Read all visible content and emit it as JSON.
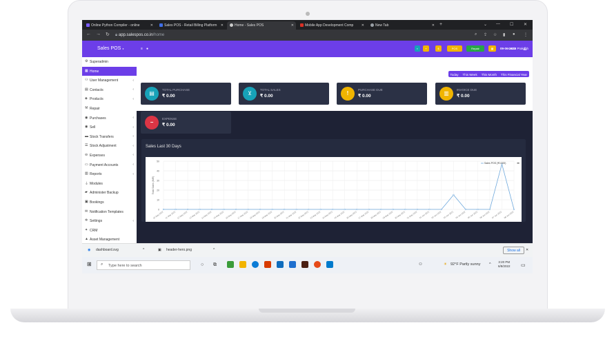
{
  "browser": {
    "tabs": [
      {
        "label": "Online Python Compiler - online",
        "color": "#7b5cff"
      },
      {
        "label": "Sales POS - Retail Billing Platform",
        "color": "#3f6ee8"
      },
      {
        "label": "Home - Sales POS",
        "color": "#cccccc"
      },
      {
        "label": "Mobile App Development Comp",
        "color": "#d93025"
      },
      {
        "label": "New Tab",
        "color": "#9aa0a6"
      }
    ],
    "url_host": "app.salespos.co.in",
    "url_path": "/home"
  },
  "app": {
    "brand": "Sales POS",
    "date": "09-06-2022",
    "user": "Lenin Prakash",
    "pos_label": "POS",
    "repair_label": "Repair"
  },
  "sidebar": {
    "items": [
      {
        "label": "Superadmin",
        "icon": "users-gear-icon",
        "chevron": false,
        "active": false
      },
      {
        "label": "Home",
        "icon": "dashboard-icon",
        "chevron": false,
        "active": true
      },
      {
        "label": "User Management",
        "icon": "users-icon",
        "chevron": true,
        "active": false
      },
      {
        "label": "Contacts",
        "icon": "address-book-icon",
        "chevron": true,
        "active": false
      },
      {
        "label": "Products",
        "icon": "cubes-icon",
        "chevron": true,
        "active": false
      },
      {
        "label": "Repair",
        "icon": "wrench-icon",
        "chevron": false,
        "active": false
      },
      {
        "label": "Purchases",
        "icon": "circle-arrow-icon",
        "chevron": true,
        "active": false
      },
      {
        "label": "Sell",
        "icon": "circle-arrow-up-icon",
        "chevron": true,
        "active": false
      },
      {
        "label": "Stock Transfers",
        "icon": "truck-icon",
        "chevron": true,
        "active": false
      },
      {
        "label": "Stock Adjustment",
        "icon": "database-icon",
        "chevron": true,
        "active": false
      },
      {
        "label": "Expenses",
        "icon": "minus-circle-icon",
        "chevron": true,
        "active": false
      },
      {
        "label": "Payment Accounts",
        "icon": "money-icon",
        "chevron": true,
        "active": false
      },
      {
        "label": "Reports",
        "icon": "bar-chart-icon",
        "chevron": true,
        "active": false
      },
      {
        "label": "Modules",
        "icon": "plug-icon",
        "chevron": false,
        "active": false
      },
      {
        "label": "Administer Backup",
        "icon": "hdd-icon",
        "chevron": false,
        "active": false
      },
      {
        "label": "Bookings",
        "icon": "calendar-check-icon",
        "chevron": false,
        "active": false
      },
      {
        "label": "Notification Templates",
        "icon": "envelope-icon",
        "chevron": false,
        "active": false
      },
      {
        "label": "Settings",
        "icon": "cog-icon",
        "chevron": true,
        "active": false
      },
      {
        "label": "CRM",
        "icon": "crm-icon",
        "chevron": false,
        "active": false
      },
      {
        "label": "Asset Management",
        "icon": "asset-icon",
        "chevron": false,
        "active": false
      }
    ]
  },
  "filters": [
    "Today",
    "This Week",
    "This Month",
    "This Financial Year"
  ],
  "cards": [
    {
      "label": "TOTAL PURCHASE",
      "value": "₹ 0.00",
      "color": "#17a2b8",
      "icon": "money-bill-icon"
    },
    {
      "label": "TOTAL SALES",
      "value": "₹ 0.00",
      "color": "#17a2b8",
      "icon": "cart-icon"
    },
    {
      "label": "PURCHASE DUE",
      "value": "₹ 0.00",
      "color": "#f0b400",
      "icon": "exclamation-icon"
    },
    {
      "label": "INVOICE DUE",
      "value": "₹ 0.00",
      "color": "#f0b400",
      "icon": "invoice-icon"
    },
    {
      "label": "EXPENSE",
      "value": "₹ 0.00",
      "color": "#dc3545",
      "icon": "minus-icon"
    }
  ],
  "sales_panel": {
    "title": "Sales Last 30 Days"
  },
  "chart_data": {
    "type": "line",
    "title": "",
    "xlabel": "",
    "ylabel": "Total Sales (INR)",
    "ylim": [
      0,
      50
    ],
    "y_ticks": [
      0,
      10,
      20,
      30,
      40,
      50
    ],
    "legend": "top-right",
    "grid": true,
    "series": [
      {
        "name": "Sales POS (₹0.000)",
        "color": "#6ea8dc",
        "values": [
          0,
          0,
          0,
          0,
          0,
          0,
          0,
          0,
          0,
          0,
          0,
          0,
          0,
          0,
          0,
          0,
          0,
          0,
          0,
          0,
          0,
          0,
          0,
          0,
          15,
          0,
          0,
          0,
          47,
          0
        ]
      }
    ],
    "categories": [
      "10 May 2022",
      "11 May 2022",
      "12 May 2022",
      "13 May 2022",
      "14 May 2022",
      "15 May 2022",
      "16 May 2022",
      "17 May 2022",
      "18 May 2022",
      "19 May 2022",
      "20 May 2022",
      "21 May 2022",
      "22 May 2022",
      "23 May 2022",
      "24 May 2022",
      "25 May 2022",
      "26 May 2022",
      "27 May 2022",
      "28 May 2022",
      "29 May 2022",
      "30 May 2022",
      "31 May 2022",
      "01 Jun 2022",
      "02 Jun 2022",
      "03 Jun 2022",
      "04 Jun 2022",
      "05 Jun 2022",
      "06 Jun 2022",
      "07 Jun 2022",
      "08 Jun 2022"
    ]
  },
  "downloads": [
    {
      "label": "dashboard.svg"
    },
    {
      "label": "header-hero.png"
    }
  ],
  "downloads_show_all": "Show all",
  "taskbar": {
    "search_placeholder": "Type here to search",
    "weather": "92°F  Partly sunny",
    "time": "3:20 PM",
    "date": "6/8/2022"
  }
}
